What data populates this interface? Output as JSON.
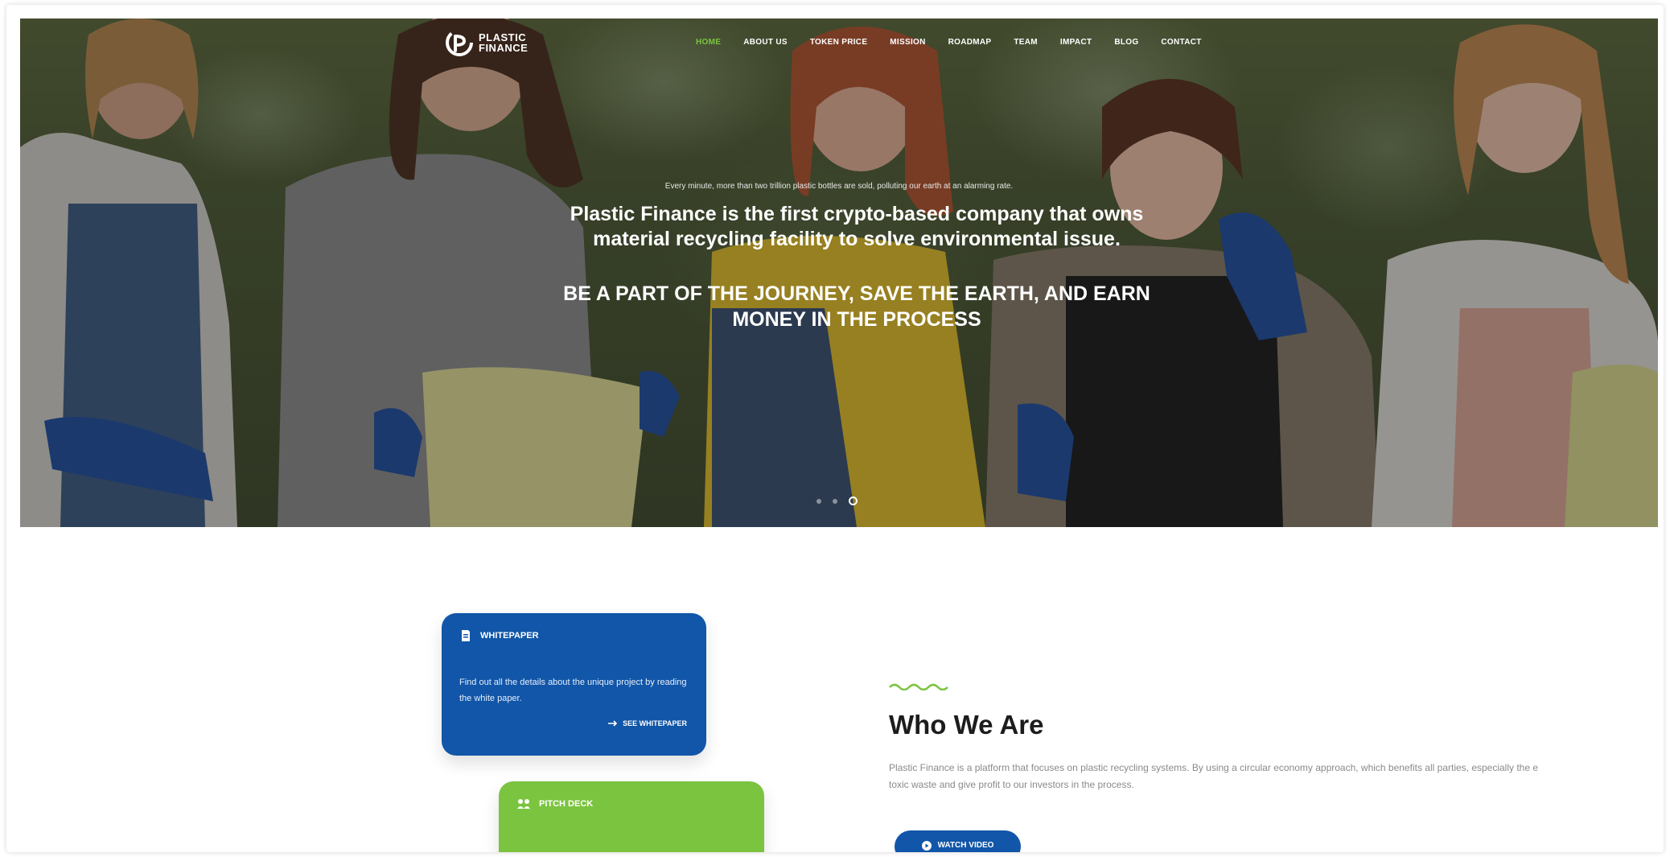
{
  "brand": {
    "name_line1": "PLASTIC",
    "name_line2": "FINANCE"
  },
  "nav": {
    "items": [
      {
        "label": "HOME",
        "active": true
      },
      {
        "label": "ABOUT US",
        "active": false
      },
      {
        "label": "TOKEN PRICE",
        "active": false
      },
      {
        "label": "MISSION",
        "active": false
      },
      {
        "label": "ROADMAP",
        "active": false
      },
      {
        "label": "TEAM",
        "active": false
      },
      {
        "label": "IMPACT",
        "active": false
      },
      {
        "label": "BLOG",
        "active": false
      },
      {
        "label": "CONTACT",
        "active": false
      }
    ]
  },
  "hero": {
    "small_text": "Every minute, more than two trillion plastic bottles are sold, polluting our earth at an alarming rate.",
    "main_text": "Plastic Finance is the first crypto-based company that owns material recycling facility to solve environmental issue.",
    "cta_text": "BE A PART OF THE JOURNEY, SAVE THE EARTH, AND EARN MONEY IN THE PROCESS",
    "slides_total": 3,
    "active_slide": 3
  },
  "cards": {
    "whitepaper": {
      "title": "WHITEPAPER",
      "body": "Find out all the details about the unique project by reading the white paper.",
      "link": "SEE WHITEPAPER",
      "icon": "document-icon"
    },
    "pitchdeck": {
      "title": "PITCH DECK",
      "icon": "presentation-icon"
    }
  },
  "about": {
    "title": "Who We Are",
    "text_line1": "Plastic Finance is a platform that focuses on plastic recycling systems. By using a circular economy approach, which benefits all parties, especially the e",
    "text_line2": "toxic waste and give profit to our investors in the process.",
    "button": "WATCH VIDEO"
  },
  "colors": {
    "brand_blue": "#1156a8",
    "brand_green": "#7bc43f",
    "heading": "#1c1c1c",
    "body_text": "#8a8a8a"
  }
}
